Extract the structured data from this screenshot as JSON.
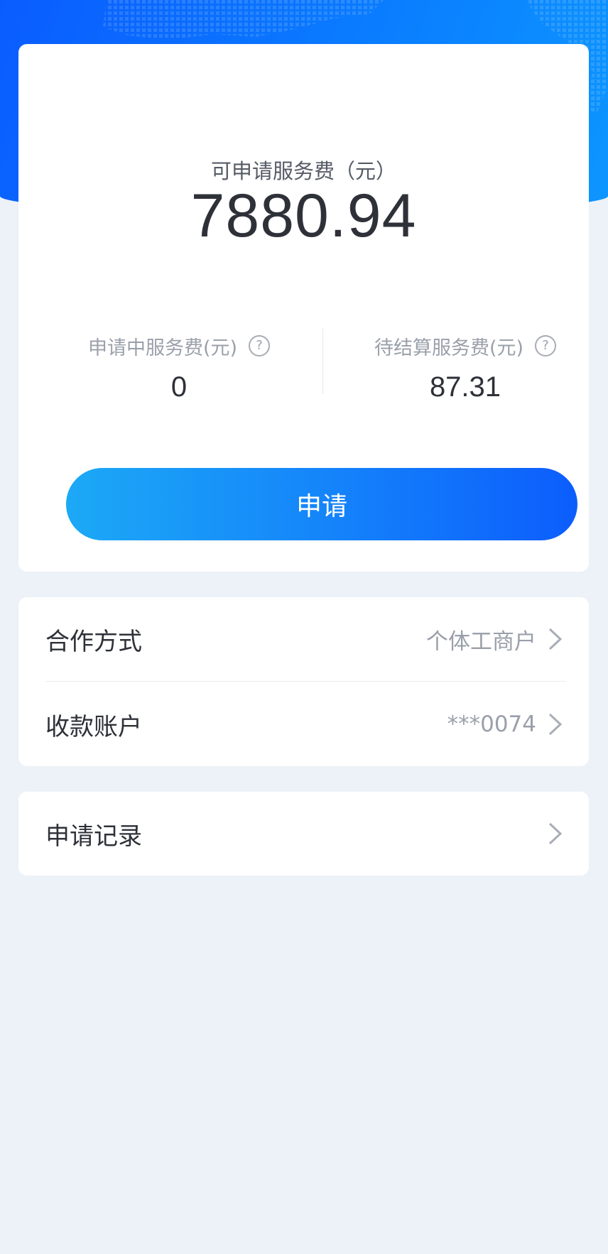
{
  "summary": {
    "available_label": "可申请服务费（元）",
    "available_value": "7880.94"
  },
  "stats": {
    "applying_label": "申请中服务费(元)",
    "applying_value": "0",
    "pending_label": "待结算服务费(元)",
    "pending_value": "87.31",
    "help_glyph": "?"
  },
  "apply_button_label": "申请",
  "settings": {
    "cooperation_label": "合作方式",
    "cooperation_value": "个体工商户",
    "account_label": "收款账户",
    "account_value": "***0074"
  },
  "records": {
    "label": "申请记录"
  },
  "colors": {
    "brand_blue": "#0c5dfc",
    "button_gradient_start": "#1ca9f6",
    "page_background": "#edf1f8"
  }
}
